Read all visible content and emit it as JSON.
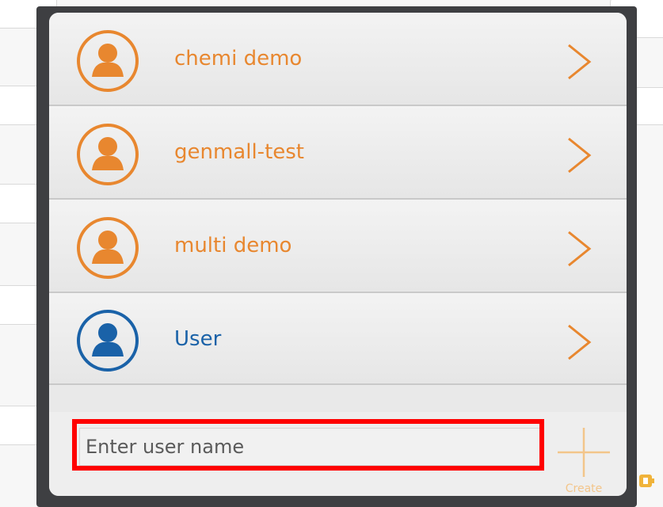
{
  "users": [
    {
      "name": "chemi demo",
      "color": "#e8872f",
      "selected": false
    },
    {
      "name": "genmall-test",
      "color": "#e8872f",
      "selected": false
    },
    {
      "name": "multi demo",
      "color": "#e8872f",
      "selected": false
    },
    {
      "name": "User",
      "color": "#1a62a8",
      "selected": true
    }
  ],
  "row_icon": "user-avatar-icon",
  "chevron_icon": "chevron-right-icon",
  "new_user": {
    "placeholder": "Enter user name",
    "value": "",
    "create_label": "Create",
    "create_icon": "plus-icon"
  },
  "colors": {
    "accent": "#e8872f",
    "selected": "#1a62a8",
    "highlight": "#ff0000"
  }
}
